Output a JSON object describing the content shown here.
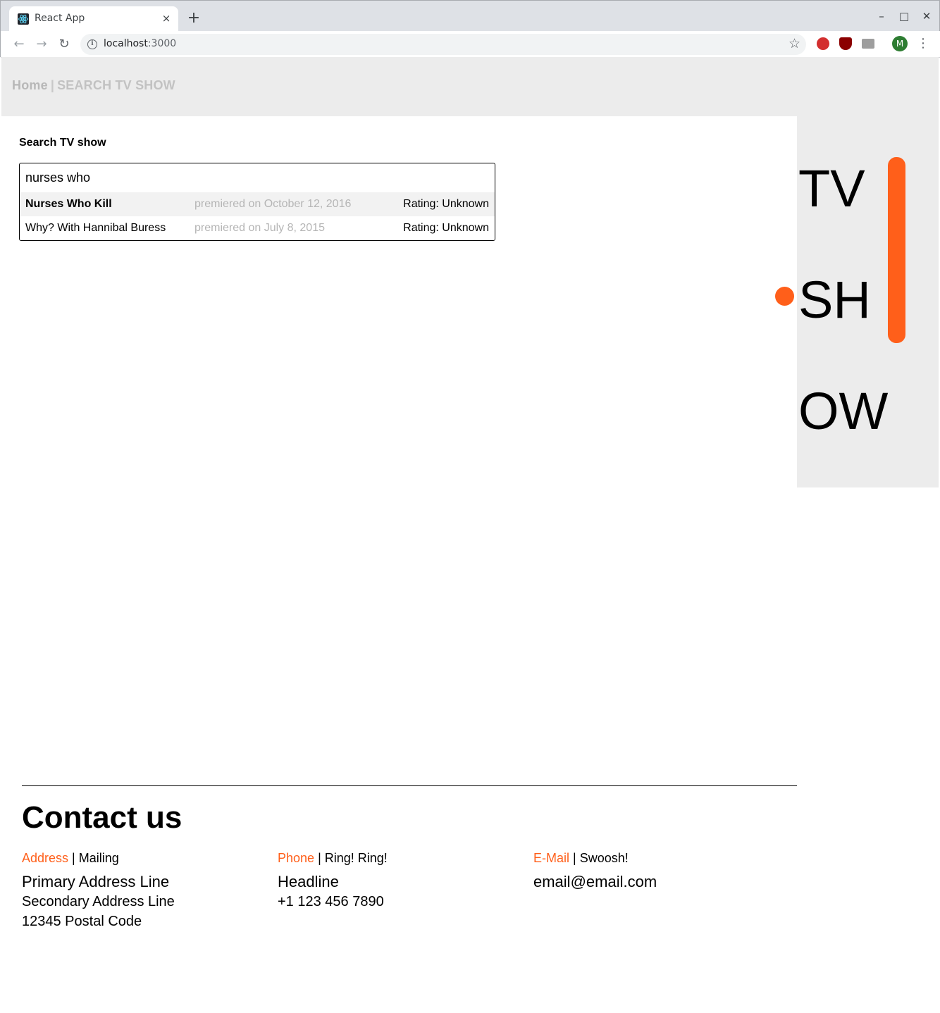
{
  "browser": {
    "tab_title": "React App",
    "tab_close": "×",
    "new_tab": "+",
    "url_host": "localhost",
    "url_port": ":3000",
    "colors": {
      "chrome_bg": "#dee1e6",
      "avatar_bg": "#2e7d32"
    },
    "avatar_letter": "M"
  },
  "site": {
    "nav": {
      "home": "Home",
      "separator": "|",
      "current": "SEARCH TV SHOW"
    },
    "side_panel": {
      "words": [
        "TV",
        "SH",
        "OW"
      ]
    },
    "accent_color": "#ff5f1a"
  },
  "search": {
    "title": "Search TV show",
    "query": "nurses who",
    "results": [
      {
        "name": "Nurses Who Kill",
        "premiere": "premiered on October 12, 2016",
        "rating": "Rating: Unknown"
      },
      {
        "name": "Why? With Hannibal Buress",
        "premiere": "premiered on July 8, 2015",
        "rating": "Rating: Unknown"
      }
    ]
  },
  "footer": {
    "title": "Contact us",
    "address": {
      "accent": "Address",
      "sep": " | ",
      "sub": "Mailing",
      "line1": "Primary Address Line",
      "line2": "Secondary Address Line",
      "line3": "12345 Postal Code"
    },
    "phone": {
      "accent": "Phone",
      "sep": " | ",
      "sub": "Ring! Ring!",
      "line1": "Headline",
      "line2": "+1 123 456 7890"
    },
    "email": {
      "accent": "E-Mail",
      "sep": " | ",
      "sub": "Swoosh!",
      "line1": "email@email.com"
    }
  }
}
